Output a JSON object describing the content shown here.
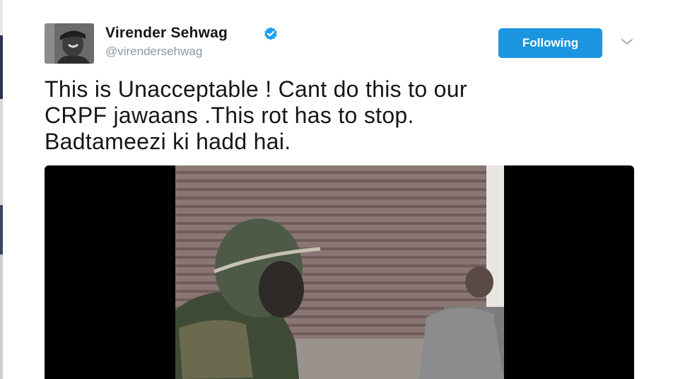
{
  "tweet": {
    "author": {
      "name": "Virender Sehwag",
      "handle": "@virendersehwag",
      "verified": true
    },
    "follow_button": {
      "label": "Following"
    },
    "text_lines": [
      "This is Unacceptable ! Cant do this to our",
      "CRPF jawaans .This rot has to stop.",
      "Badtameezi ki hadd hai."
    ]
  },
  "colors": {
    "accent": "#1b95e0",
    "name": "#14171a",
    "handle": "#8899a6",
    "media_background": "#000000"
  },
  "icons": {
    "verified": "verified-badge-icon",
    "caret": "chevron-down-icon"
  }
}
